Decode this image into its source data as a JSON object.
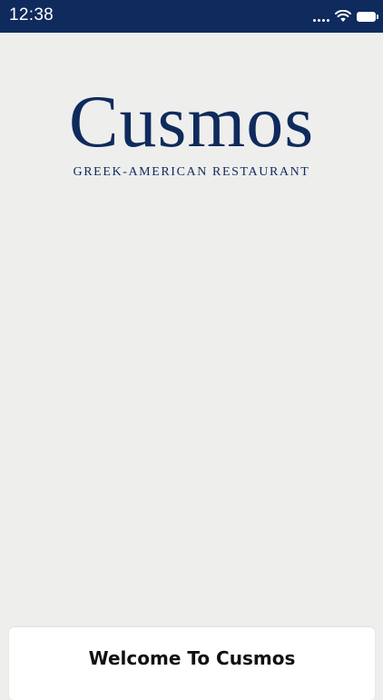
{
  "status_bar": {
    "time": "12:38",
    "icons": [
      "cellular-signal-icon",
      "wifi-icon",
      "battery-icon"
    ]
  },
  "logo": {
    "name": "Cusmos",
    "tagline": "GREEK-AMERICAN RESTAURANT"
  },
  "welcome": {
    "title": "Welcome To Cusmos"
  },
  "colors": {
    "brand_navy": "#0f2a5c",
    "background": "#eeeeed",
    "card": "#ffffff"
  }
}
